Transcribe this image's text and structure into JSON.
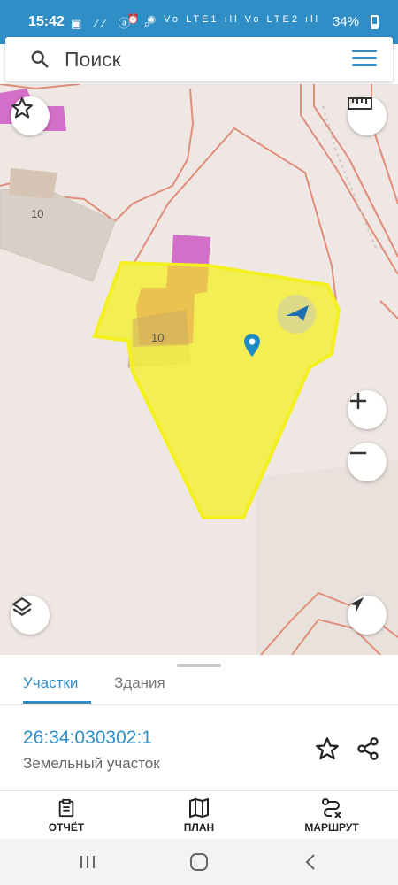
{
  "status_bar": {
    "time": "15:42",
    "left_icons": "▣ ⁄⁄ ⓐ ⌕",
    "right_icons": "⏰ ◉ Vo LTE1 ıll Vo LTE2 ıll",
    "battery": "34%"
  },
  "search": {
    "placeholder": "Поиск"
  },
  "map": {
    "label_1": "10",
    "label_2": "10"
  },
  "panel": {
    "tabs": [
      {
        "label": "Участки"
      },
      {
        "label": "Здания"
      }
    ],
    "parcel": {
      "cadastral_number": "26:34:030302:1",
      "type": "Земельный участок"
    },
    "actions": [
      {
        "label": "ОТЧЁТ"
      },
      {
        "label": "ПЛАН"
      },
      {
        "label": "МАРШРУТ"
      }
    ]
  },
  "icons": [
    "search-icon",
    "menu-icon",
    "star-icon",
    "ruler-icon",
    "zoom-in-icon",
    "zoom-out-icon",
    "layers-icon",
    "my-location-icon",
    "share-icon",
    "report-icon",
    "map-icon",
    "route-icon",
    "recent-apps-icon",
    "home-icon",
    "back-icon"
  ],
  "colors": {
    "accent": "#2f8ec6",
    "parcel_fill": "#f4ee3c",
    "parcel_stroke": "#f4ef1e",
    "building": "#d36fc8"
  }
}
